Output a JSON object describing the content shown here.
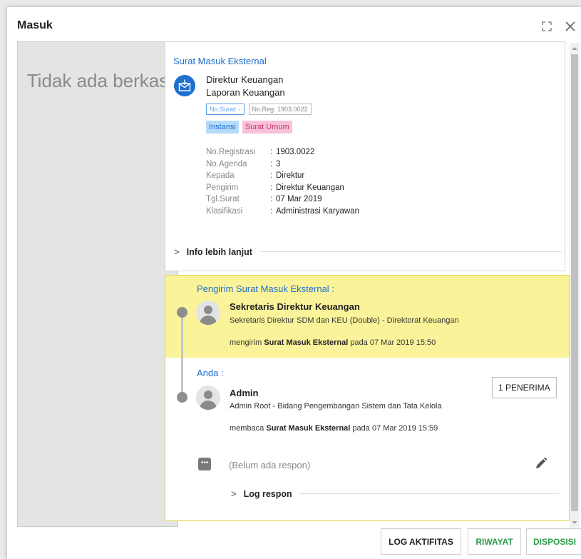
{
  "dialog": {
    "title": "Masuk"
  },
  "viewer": {
    "empty_text": "Tidak ada berkas"
  },
  "letter": {
    "type_title": "Surat Masuk Eksternal",
    "sender": "Direktur Keuangan",
    "subject": "Laporan Keuangan",
    "no_surat_tag": "No.Surat: -",
    "no_reg_tag": "No.Reg: 1903.0022",
    "labels": [
      "Instansi",
      "Surat Umum"
    ],
    "details": [
      {
        "key": "No.Registrasi",
        "value": "1903.0022"
      },
      {
        "key": "No.Agenda",
        "value": "3"
      },
      {
        "key": "Kepada",
        "value": "Direktur"
      },
      {
        "key": "Pengirim",
        "value": "Direktur Keuangan"
      },
      {
        "key": "Tgl.Surat",
        "value": "07 Mar 2019"
      },
      {
        "key": "Klasifikasi",
        "value": "Administrasi Karyawan"
      }
    ],
    "more_info_label": "Info lebih lanjut"
  },
  "log": {
    "sender_section": {
      "label": "Pengirim Surat Masuk Eksternal :",
      "name": "Sekretaris Direktur Keuangan",
      "unit": "Sekretaris Direktur SDM dan KEU (Double) - Direktorat Keuangan",
      "action_verb": "mengirim",
      "action_object": "Surat Masuk Eksternal",
      "action_suffix": "pada 07 Mar 2019 15:50"
    },
    "reader_section": {
      "label": "Anda :",
      "name": "Admin",
      "unit": "Admin Root - Bidang Pengembangan Sistem dan Tata Kelola",
      "action_verb": "membaca",
      "action_object": "Surat Masuk Eksternal",
      "action_suffix": "pada 07 Mar 2019 15:59",
      "recipients_button": "1 PENERIMA",
      "no_reply_text": "(Belum ada respon)",
      "log_reply_label": "Log respon"
    }
  },
  "footer": {
    "log_button": "LOG AKTIFITAS",
    "history_button": "RIWAYAT",
    "disposition_button": "DISPOSISI"
  },
  "colors": {
    "accent_blue": "#1e6fcf",
    "highlight_yellow": "#fbf39a",
    "action_green": "#2e9c4d"
  }
}
